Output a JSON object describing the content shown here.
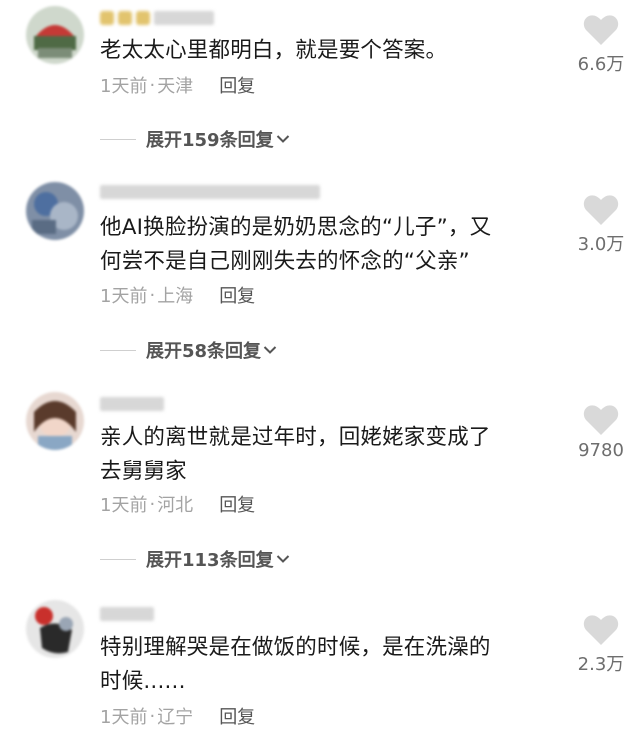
{
  "comments": [
    {
      "text": "老太太心里都明白，就是要个答案。",
      "time": "1天前",
      "separator": "·",
      "location": "天津",
      "reply_label": "回复",
      "likes": "6.6万",
      "expand_label": "展开159条回复"
    },
    {
      "text": "他AI换脸扮演的是奶奶思念的“儿子”，又\n何尝不是自己刚刚失去的怀念的“父亲”",
      "time": "1天前",
      "separator": "·",
      "location": "上海",
      "reply_label": "回复",
      "likes": "3.0万",
      "expand_label": "展开58条回复"
    },
    {
      "text": "亲人的离世就是过年时，回姥姥家变成了\n去舅舅家",
      "time": "1天前",
      "separator": "·",
      "location": "河北",
      "reply_label": "回复",
      "likes": "9780",
      "expand_label": "展开113条回复"
    },
    {
      "text": "特别理解哭是在做饭的时候，是在洗澡的\n时候......",
      "time": "1天前",
      "separator": "·",
      "location": "辽宁",
      "reply_label": "回复",
      "likes": "2.3万"
    }
  ],
  "icons": {
    "like": "heart-icon",
    "expand": "chevron-down-icon"
  },
  "colors": {
    "text": "#1a1a1a",
    "meta": "#a3a3a3",
    "heart": "#d9d9d9"
  }
}
